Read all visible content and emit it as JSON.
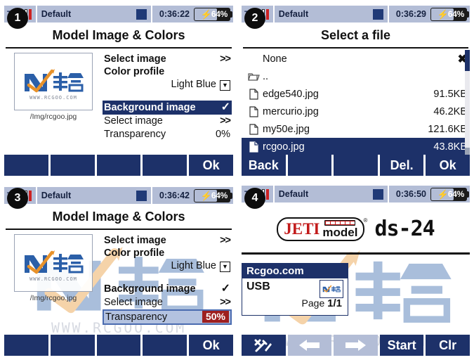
{
  "device": {
    "brand": "JETI",
    "brand_sub": "model",
    "model": "ds-24",
    "accent_dark": "#1d3169",
    "accent_light": "#b3bdd6",
    "status_red": "#9e1f1f"
  },
  "panels": [
    {
      "badge": "1",
      "statusbar": {
        "tx_label": "Tx",
        "profile": "Default",
        "time": "0:36:22",
        "battery_pct": "64%",
        "charging_icon": "lightning-bolt-icon"
      },
      "title": "Model Image & Colors",
      "image": {
        "path": "/Img/rcgoo.jpg",
        "alt": "rcgoo-logo"
      },
      "menu": [
        {
          "label": "Select image",
          "value": ">>",
          "bold": true
        },
        {
          "label": "Color profile",
          "value": "",
          "bold": true
        },
        {
          "label": "",
          "value": "Light Blue",
          "dropdown": true
        },
        {
          "label": "Background image",
          "value": "✓",
          "selected": true
        },
        {
          "label": "Select image",
          "value": ">>"
        },
        {
          "label": "Transparency",
          "value": "0%"
        }
      ],
      "footer": [
        "",
        "",
        "",
        "",
        "Ok"
      ]
    },
    {
      "badge": "2",
      "statusbar": {
        "tx_label": "Tx",
        "profile": "Default",
        "time": "0:36:29",
        "battery_pct": "64%",
        "charging_icon": "lightning-bolt-icon"
      },
      "title": "Select a file",
      "files": [
        {
          "icon": "none",
          "name": "None",
          "size": "✖",
          "selected": false
        },
        {
          "icon": "folder-icon",
          "name": "..",
          "size": "",
          "selected": false
        },
        {
          "icon": "file-icon",
          "name": "edge540.jpg",
          "size": "91.5KB",
          "selected": false
        },
        {
          "icon": "file-icon",
          "name": "mercurio.jpg",
          "size": "46.2KB",
          "selected": false
        },
        {
          "icon": "file-icon",
          "name": "my50e.jpg",
          "size": "121.6KB",
          "selected": false
        },
        {
          "icon": "file-icon",
          "name": "rcgoo.jpg",
          "size": "43.8KB",
          "selected": true
        }
      ],
      "footer": [
        "Back",
        "",
        "",
        "Del.",
        "Ok"
      ]
    },
    {
      "badge": "3",
      "statusbar": {
        "tx_label": "Tx",
        "profile": "Default",
        "time": "0:36:42",
        "battery_pct": "64%",
        "charging_icon": "lightning-bolt-icon"
      },
      "title": "Model Image & Colors",
      "image": {
        "path": "/Img/rcgoo.jpg",
        "alt": "rcgoo-logo"
      },
      "menu": [
        {
          "label": "Select image",
          "value": ">>",
          "bold": true
        },
        {
          "label": "Color profile",
          "value": "",
          "bold": true
        },
        {
          "label": "",
          "value": "Light Blue",
          "dropdown": true
        },
        {
          "label": "Background image",
          "value": "✓",
          "bold": true
        },
        {
          "label": "Select image",
          "value": ">>"
        },
        {
          "label": "Transparency",
          "value": "50%",
          "focused": true
        }
      ],
      "footer": [
        "",
        "",
        "",
        "",
        "Ok"
      ]
    },
    {
      "badge": "4",
      "statusbar": {
        "tx_label": "Tx",
        "profile": "Default",
        "time": "0:36:50",
        "battery_pct": "64%",
        "charging_icon": "lightning-bolt-icon"
      },
      "widget": {
        "title": "Rcgoo.com",
        "usb_label": "USB",
        "page_label": "Page",
        "page_value": "1/1",
        "thumb_alt": "rcgoo-logo-thumb"
      },
      "footer": [
        "tools-icon",
        "arrow-left-icon",
        "arrow-right-icon",
        "Start",
        "Clr"
      ]
    }
  ]
}
